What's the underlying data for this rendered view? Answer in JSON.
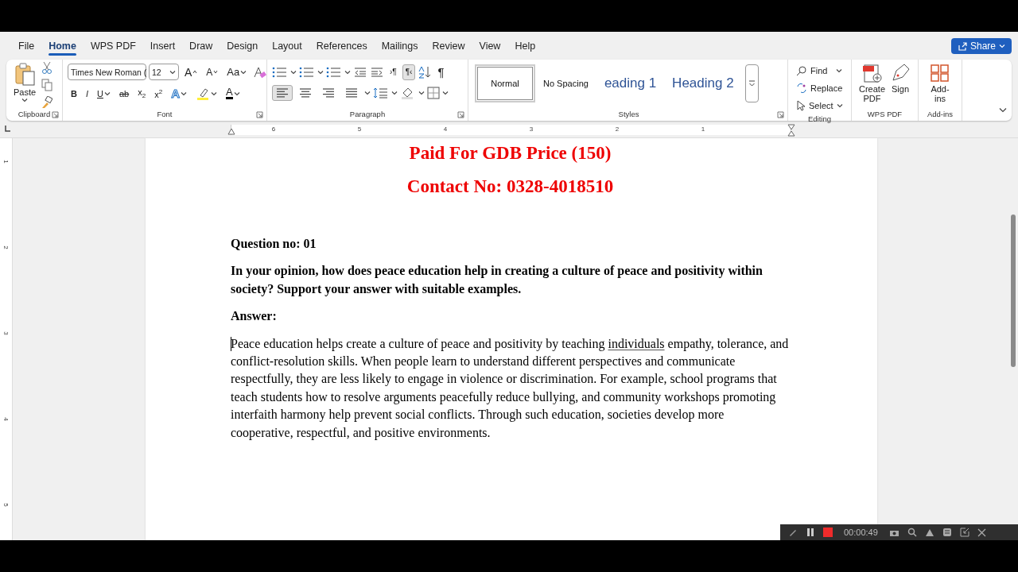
{
  "menu_tabs": [
    {
      "label": "File",
      "selected": false
    },
    {
      "label": "Home",
      "selected": true
    },
    {
      "label": "WPS PDF",
      "selected": false
    },
    {
      "label": "Insert",
      "selected": false
    },
    {
      "label": "Draw",
      "selected": false
    },
    {
      "label": "Design",
      "selected": false
    },
    {
      "label": "Layout",
      "selected": false
    },
    {
      "label": "References",
      "selected": false
    },
    {
      "label": "Mailings",
      "selected": false
    },
    {
      "label": "Review",
      "selected": false
    },
    {
      "label": "View",
      "selected": false
    },
    {
      "label": "Help",
      "selected": false
    }
  ],
  "share_button": "Share",
  "ribbon": {
    "clipboard": {
      "paste": "Paste",
      "group": "Clipboard"
    },
    "font": {
      "name": "Times New Roman (",
      "size": "12",
      "grow": "A",
      "shrink": "A",
      "change_case": "Aa",
      "effects": "A",
      "font_color": "A",
      "group": "Font",
      "format_buttons": [
        {
          "kind": "bold",
          "label": "B"
        },
        {
          "kind": "italic",
          "label": "I"
        },
        {
          "kind": "underline",
          "label": "U"
        },
        {
          "kind": "strike",
          "label": "ab"
        },
        {
          "kind": "subscript",
          "label": "x$_{2}$"
        },
        {
          "kind": "superscript",
          "label": "x$^{2}$"
        }
      ]
    },
    "paragraph": {
      "group": "Paragraph",
      "show_marks": "¶",
      "direction_buttons": [
        {
          "label": "›¶",
          "selected": false
        },
        {
          "label": "¶‹",
          "selected": true
        }
      ],
      "alignments": [
        {
          "kind": "left",
          "selected": true
        },
        {
          "kind": "center",
          "selected": false
        },
        {
          "kind": "right",
          "selected": false
        },
        {
          "kind": "justify",
          "selected": false
        }
      ]
    },
    "styles": {
      "group": "Styles",
      "items": [
        {
          "label": "Normal",
          "kind": "normal",
          "selected": true
        },
        {
          "label": "No Spacing",
          "kind": "normal",
          "selected": false
        },
        {
          "label": "eading 1",
          "kind": "heading",
          "selected": false
        },
        {
          "label": "Heading 2",
          "kind": "heading",
          "selected": false
        }
      ]
    },
    "editing": {
      "find": "Find",
      "replace": "Replace",
      "select": "Select",
      "group": "Editing"
    },
    "wps_pdf": {
      "create": "Create PDF",
      "sign": "Sign",
      "group": "WPS PDF"
    },
    "addins": {
      "button": "Add-ins",
      "group": "Add-ins"
    }
  },
  "horizontal_ruler": [
    "6",
    "5",
    "4",
    "3",
    "2",
    "1"
  ],
  "vertical_ruler": [
    "1",
    "2",
    "3",
    "4",
    "5"
  ],
  "document": {
    "headers": [
      "Paid For GDB Price (150)",
      "Contact No: 0328-4018510"
    ],
    "question_label": "Question no: 01",
    "question": "In your opinion, how does peace education help in creating a culture of peace and positivity within society? Support your answer with suitable examples.",
    "answer_label": "Answer:",
    "answer": {
      "before": "Peace education helps create a culture of peace and positivity by teaching ",
      "flagged": "individuals",
      "after": " empathy, tolerance, and conflict-resolution skills. When people learn to understand different perspectives and communicate respectfully, they are less likely to engage in violence or discrimination. For example, school programs that teach students how to resolve arguments peacefully reduce bullying, and community workshops promoting interfaith harmony help prevent social conflicts. Through such education, societies develop more cooperative, respectful, and positive environments."
    }
  },
  "recorder": {
    "time": "00:00:49"
  }
}
